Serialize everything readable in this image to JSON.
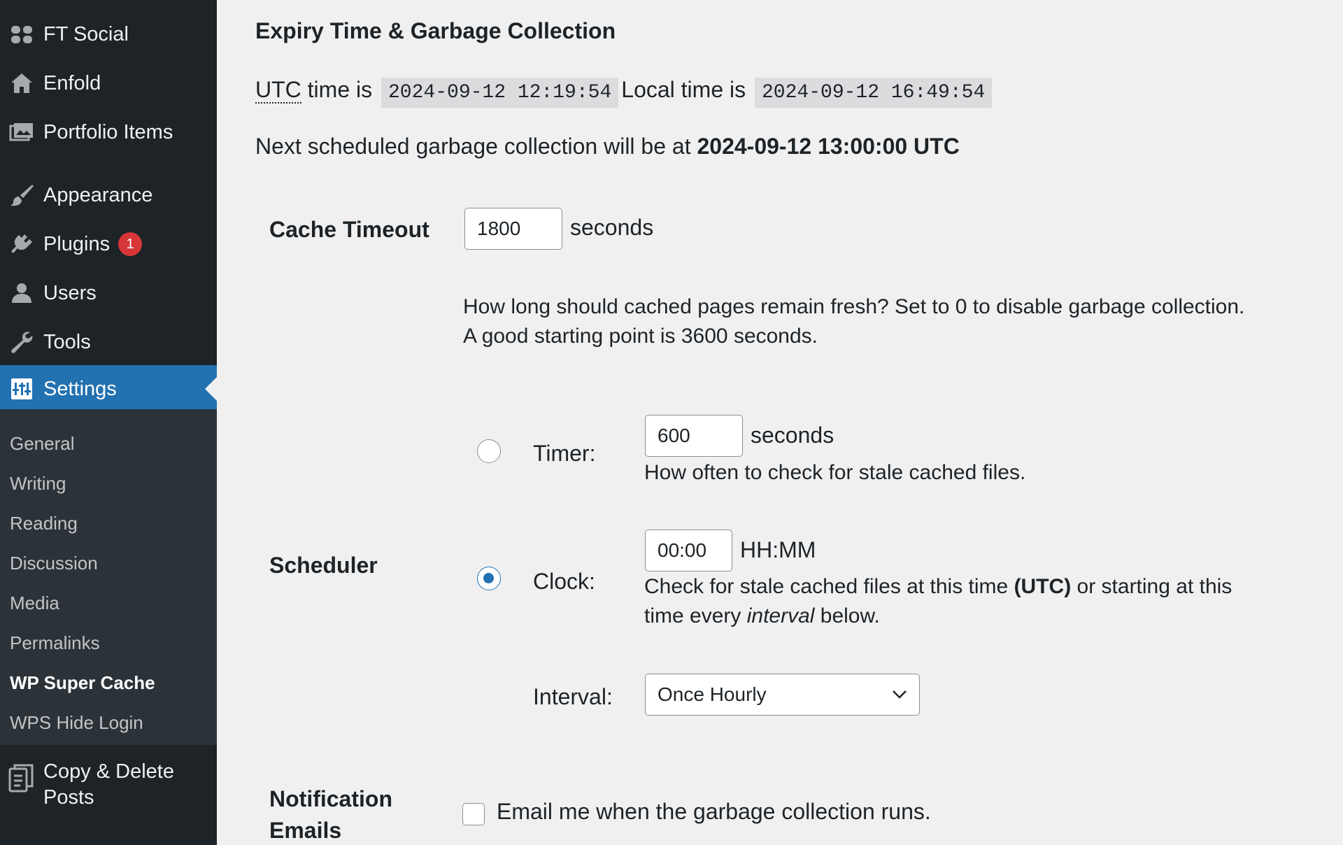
{
  "sidebar": {
    "items": [
      {
        "label": "FT Social",
        "icon": "ft-social-icon"
      },
      {
        "label": "Enfold",
        "icon": "home-icon"
      },
      {
        "label": "Portfolio Items",
        "icon": "portfolio-icon"
      },
      {
        "label": "Appearance",
        "icon": "paintbrush-icon"
      },
      {
        "label": "Plugins",
        "icon": "plugin-icon",
        "badge": "1"
      },
      {
        "label": "Users",
        "icon": "user-icon"
      },
      {
        "label": "Tools",
        "icon": "wrench-icon"
      },
      {
        "label": "Settings",
        "icon": "settings-icon"
      }
    ],
    "submenu": [
      "General",
      "Writing",
      "Reading",
      "Discussion",
      "Media",
      "Permalinks",
      "WP Super Cache",
      "WPS Hide Login"
    ],
    "current_submenu": "WP Super Cache",
    "copy_delete": {
      "line1": "Copy & Delete",
      "line2": "Posts",
      "icon": "copy-delete-icon"
    },
    "accent_color": "#2271b1",
    "badge_color": "#d63638"
  },
  "main": {
    "title": "Expiry Time & Garbage Collection",
    "time": {
      "utc_abbr": "UTC",
      "utc_prefix_rest": " time is",
      "utc_value": "2024-09-12 12:19:54",
      "local_prefix": "Local time is",
      "local_value": "2024-09-12 16:49:54"
    },
    "next_gc": {
      "prefix": "Next scheduled garbage collection will be at ",
      "value": "2024-09-12 13:00:00 UTC"
    },
    "cache_timeout": {
      "label": "Cache Timeout",
      "value": "1800",
      "unit": "seconds",
      "desc_line1": "How long should cached pages remain fresh? Set to 0 to disable garbage collection.",
      "desc_line2": "A good starting point is 3600 seconds."
    },
    "scheduler": {
      "label": "Scheduler",
      "timer": {
        "label": "Timer:",
        "value": "600",
        "unit": "seconds",
        "desc": "How often to check for stale cached files.",
        "checked": false
      },
      "clock": {
        "label": "Clock:",
        "value": "00:00",
        "unit": "HH:MM",
        "desc_part1": "Check for stale cached files at this time ",
        "desc_bold": "(UTC)",
        "desc_part2": " or starting at this",
        "desc_line2_a": "time every ",
        "desc_line2_em": "interval",
        "desc_line2_b": " below.",
        "checked": true
      },
      "interval": {
        "label": "Interval:",
        "selected": "Once Hourly"
      }
    },
    "notification": {
      "label_line1": "Notification",
      "label_line2": "Emails",
      "checkbox_label": "Email me when the garbage collection runs.",
      "checked": false
    }
  }
}
